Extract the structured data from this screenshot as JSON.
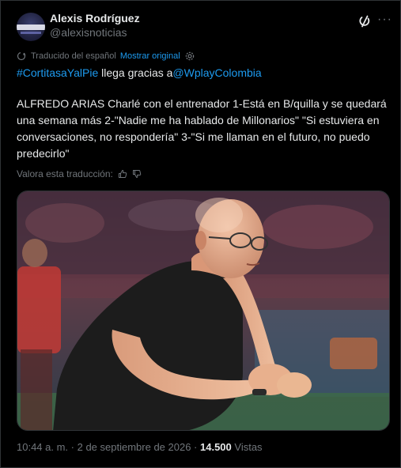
{
  "author": {
    "name": "Alexis Rodríguez",
    "handle": "@alexisnoticias"
  },
  "translation": {
    "note": "Traducido del español",
    "show_original_label": "Mostrar original"
  },
  "tweet": {
    "hashtag": "#CortitasaYalPie",
    "connector": " llega gracias a",
    "mention": "@WplayColombia",
    "body": "ALFREDO ARIAS Charlé con el entrenador 1-Está en B/quilla y se quedará una semana más 2-\"Nadie me ha hablado de Millonarios\" \"Si estuviera en conversaciones, no respondería\" 3-\"Si me llaman en el futuro, no puedo predecirlo\""
  },
  "rating": {
    "label": "Valora esta traducción:"
  },
  "meta": {
    "time": "10:44 a. m.",
    "separator1": " · ",
    "date": "2 de septiembre de 2026",
    "separator2": " · ",
    "views_count": "14.500",
    "views_label": " Vistas"
  },
  "icons": {
    "grok": "grok-icon",
    "more": "more-icon",
    "translate": "translate-icon",
    "settings": "gear-icon",
    "thumbs_up": "thumbs-up-icon",
    "thumbs_down": "thumbs-down-icon"
  },
  "colors": {
    "background": "#000000",
    "text": "#e7e9ea",
    "muted": "#71767b",
    "link": "#1d9bf0"
  }
}
